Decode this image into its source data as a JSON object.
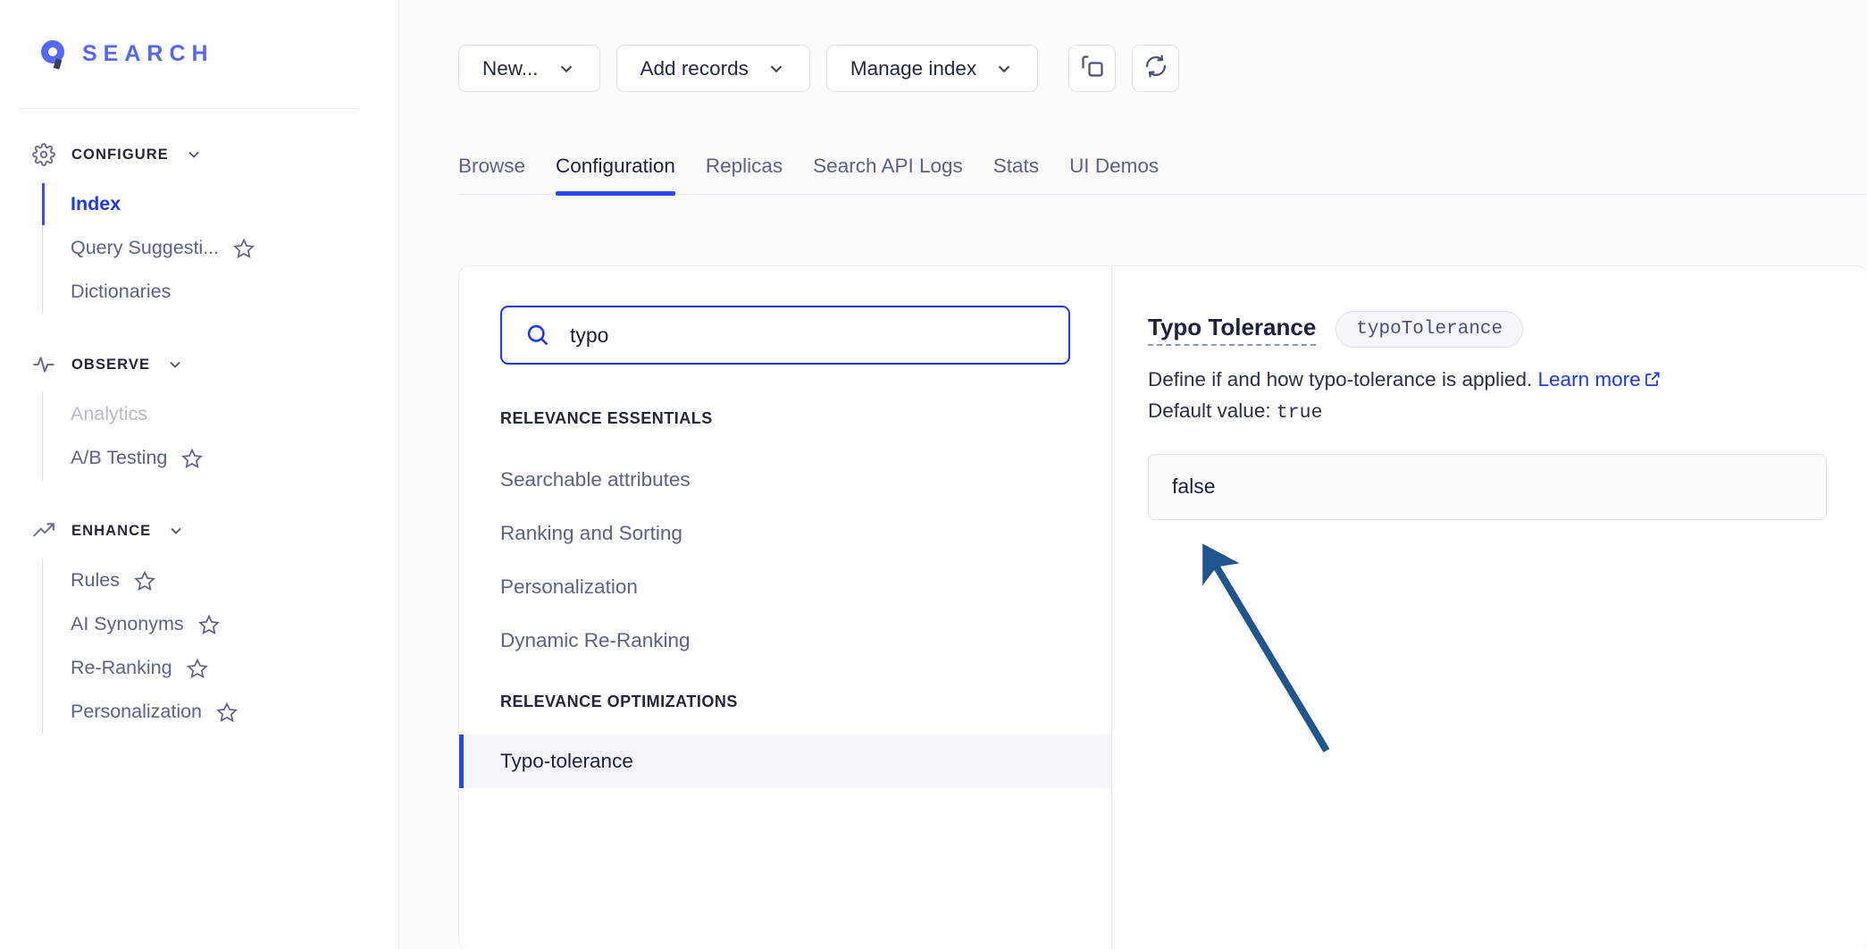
{
  "brand": {
    "name": "SEARCH",
    "logo_icon": "algolia-logo-icon",
    "color": "#5468ff"
  },
  "sidebar": {
    "groups": [
      {
        "title": "CONFIGURE",
        "icon": "gear-icon",
        "items": [
          {
            "label": "Index",
            "active": true,
            "star": false,
            "disabled": false
          },
          {
            "label": "Query Suggesti...",
            "active": false,
            "star": true,
            "disabled": false
          },
          {
            "label": "Dictionaries",
            "active": false,
            "star": false,
            "disabled": false
          }
        ]
      },
      {
        "title": "OBSERVE",
        "icon": "pulse-icon",
        "items": [
          {
            "label": "Analytics",
            "active": false,
            "star": false,
            "disabled": true
          },
          {
            "label": "A/B Testing",
            "active": false,
            "star": true,
            "disabled": false
          }
        ]
      },
      {
        "title": "ENHANCE",
        "icon": "trending-up-icon",
        "items": [
          {
            "label": "Rules",
            "active": false,
            "star": true,
            "disabled": false
          },
          {
            "label": "AI Synonyms",
            "active": false,
            "star": true,
            "disabled": false
          },
          {
            "label": "Re-Ranking",
            "active": false,
            "star": true,
            "disabled": false
          },
          {
            "label": "Personalization",
            "active": false,
            "star": true,
            "disabled": false
          }
        ]
      }
    ]
  },
  "toolbar": {
    "buttons": [
      {
        "label": "New...",
        "caret": true
      },
      {
        "label": "Add records",
        "caret": true
      },
      {
        "label": "Manage index",
        "caret": true
      }
    ],
    "icon_buttons": [
      {
        "name": "copy-index-icon"
      },
      {
        "name": "refresh-icon"
      }
    ]
  },
  "tabs": {
    "items": [
      {
        "label": "Browse",
        "active": false
      },
      {
        "label": "Configuration",
        "active": true
      },
      {
        "label": "Replicas",
        "active": false
      },
      {
        "label": "Search API Logs",
        "active": false
      },
      {
        "label": "Stats",
        "active": false
      },
      {
        "label": "UI Demos",
        "active": false
      }
    ],
    "active_underline_color": "#2545ff"
  },
  "settings_panel": {
    "search": {
      "value": "typo",
      "placeholder": "Search settings",
      "icon": "search-icon",
      "focus_color": "#1b37ff"
    },
    "sections": [
      {
        "heading": "RELEVANCE ESSENTIALS",
        "items": [
          {
            "label": "Searchable attributes",
            "selected": false
          },
          {
            "label": "Ranking and Sorting",
            "selected": false
          },
          {
            "label": "Personalization",
            "selected": false
          },
          {
            "label": "Dynamic Re-Ranking",
            "selected": false
          }
        ]
      },
      {
        "heading": "RELEVANCE OPTIMIZATIONS",
        "items": [
          {
            "label": "Typo-tolerance",
            "selected": true
          }
        ]
      }
    ]
  },
  "detail": {
    "title": "Typo Tolerance",
    "badge": "typoTolerance",
    "description": "Define if and how typo-tolerance is applied.",
    "learn_more": "Learn more",
    "learn_more_icon": "external-link-icon",
    "default_label": "Default value:",
    "default_value": "true",
    "select_value": "false"
  },
  "annotation": {
    "arrow_color": "#1f558f",
    "points_to": "typo-tolerance-select"
  }
}
